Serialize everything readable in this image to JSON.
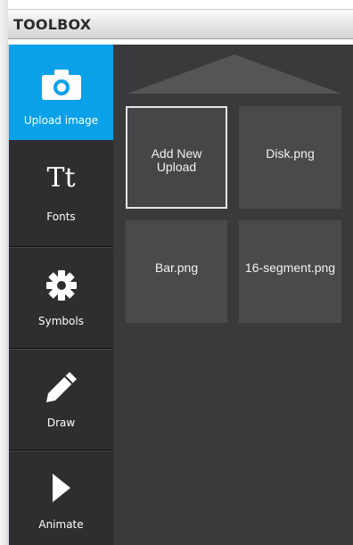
{
  "header": {
    "title": "TOOLBOX"
  },
  "sidebar": {
    "active_index": 0,
    "items": [
      {
        "label": "Upload image",
        "icon": "camera-icon"
      },
      {
        "label": "Fonts",
        "icon": "font-tt-icon",
        "icon_text": "Tt"
      },
      {
        "label": "Symbols",
        "icon": "gear-icon"
      },
      {
        "label": "Draw",
        "icon": "pencil-icon"
      },
      {
        "label": "Animate",
        "icon": "play-icon"
      }
    ]
  },
  "content": {
    "scroll_up_icon": "arrow-up-icon",
    "tiles": [
      {
        "label_line1": "Add New",
        "label_line2": "Upload",
        "selected": true
      },
      {
        "label": "Disk.png"
      },
      {
        "label": "Bar.png"
      },
      {
        "label": "16-segment.png"
      }
    ]
  },
  "colors": {
    "accent": "#0aa1e8",
    "sidebar_bg": "#2e2e30",
    "content_bg": "#3a3a3c",
    "tile_bg": "#4a4a4c"
  }
}
